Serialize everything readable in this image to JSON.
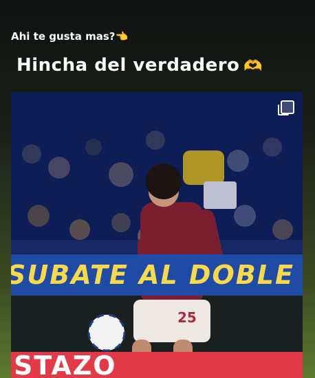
{
  "story": {
    "caption": "Ahi te gusta mas?",
    "caption_emoji": "👈",
    "title": "Hincha del verdadero",
    "title_emoji": "🫶"
  },
  "media": {
    "player_number": "25",
    "ad_text_top": "SUBATE AL DOBLE",
    "ad_text_bottom": "STAZO"
  },
  "colors": {
    "shirt": "#7a1f2f",
    "stadium_blue": "#1f4aa6",
    "ad_yellow": "#f7d94a",
    "ad_red": "#e23a46"
  },
  "icons": [
    "multi-photo-icon"
  ]
}
